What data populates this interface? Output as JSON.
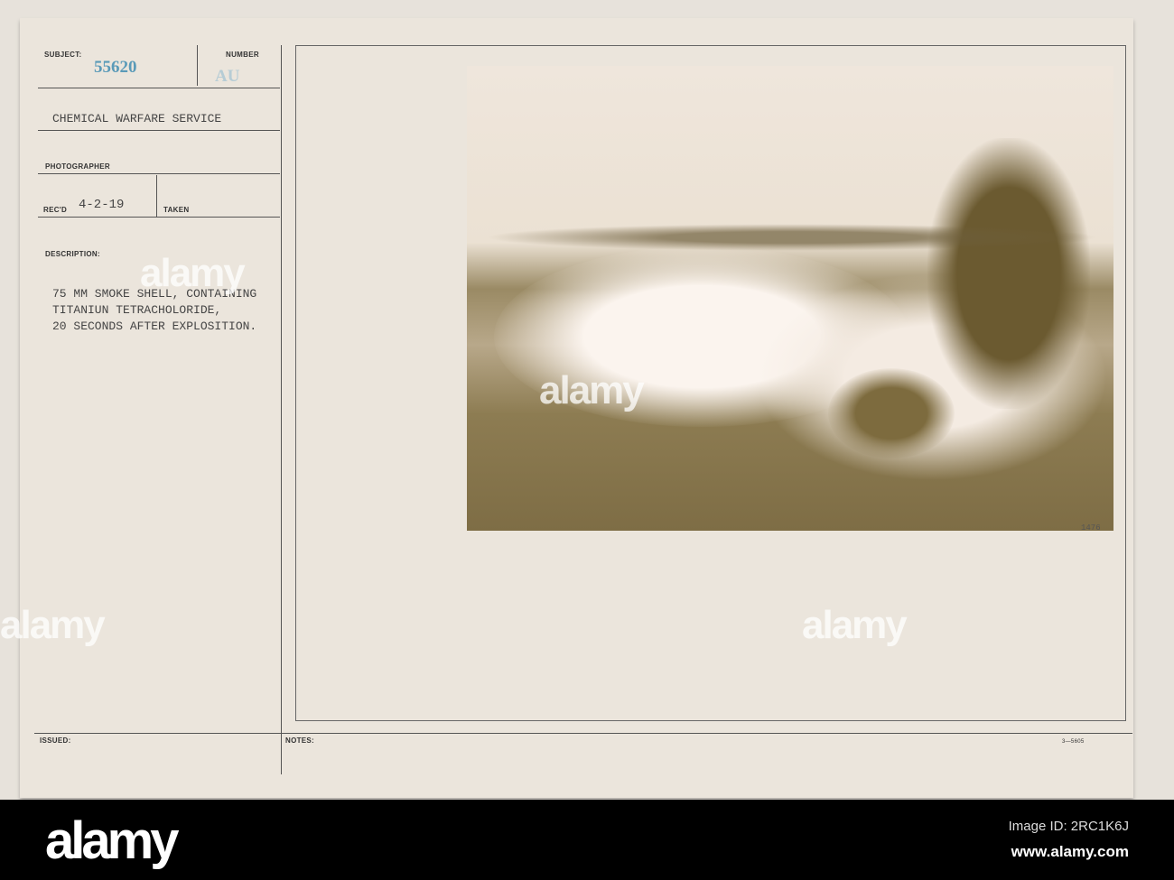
{
  "card": {
    "subject_label": "SUBJECT:",
    "subject_number": "55620",
    "number_label": "NUMBER",
    "number_value": "AU",
    "organization": "CHEMICAL WARFARE SERVICE",
    "photographer_label": "PHOTOGRAPHER",
    "received_label": "REC'D",
    "received_date": "4-2-19",
    "taken_label": "TAKEN",
    "description_label": "DESCRIPTION:",
    "description_lines": [
      "75 MM SMOKE SHELL, CONTAINING",
      "TITANIUN TETRACHOLORIDE,",
      "20 SECONDS AFTER EXPLOSITION."
    ],
    "issued_label": "ISSUED:",
    "notes_label": "NOTES:",
    "form_code": "3—5605",
    "photo_number": "1476"
  },
  "watermark": {
    "text": "alamy",
    "image_id": "Image ID: 2RC1K6J",
    "url": "www.alamy.com"
  }
}
